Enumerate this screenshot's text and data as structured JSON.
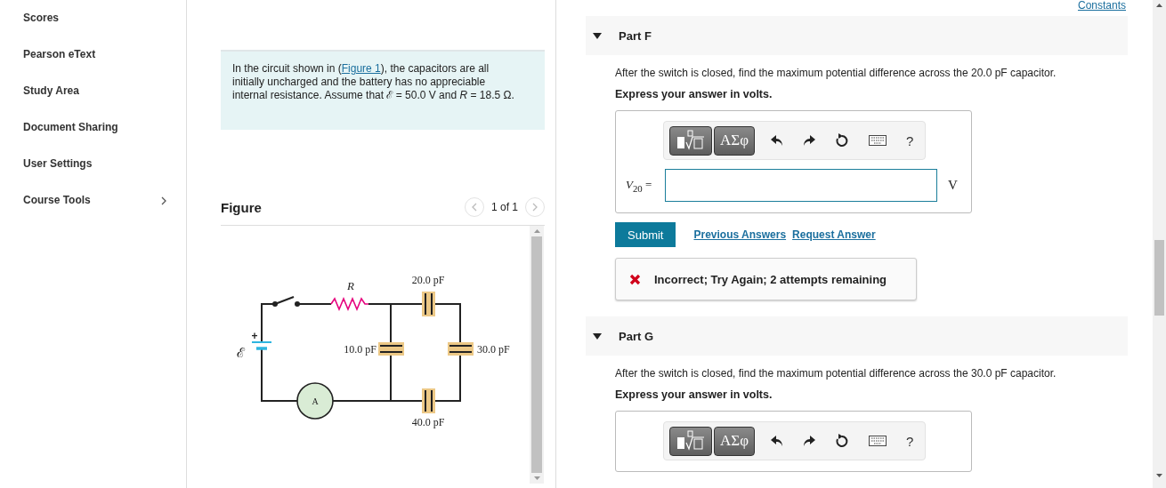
{
  "sidebar": {
    "items": [
      {
        "label": "Scores",
        "expandable": false
      },
      {
        "label": "Pearson eText",
        "expandable": false
      },
      {
        "label": "Study Area",
        "expandable": false
      },
      {
        "label": "Document Sharing",
        "expandable": false
      },
      {
        "label": "User Settings",
        "expandable": false
      },
      {
        "label": "Course Tools",
        "expandable": true
      }
    ]
  },
  "problem": {
    "before": "In the circuit shown in (",
    "link": "Figure 1",
    "after": "), the capacitors are all initially uncharged and the battery has no appreciable internal resistance. Assume that ℰ = 50.0 V and *R* = 18.5 Ω."
  },
  "figure": {
    "title": "Figure",
    "pager": "1 of 1",
    "prev_disabled": true,
    "next_disabled": true,
    "circuit_labels": {
      "emf": "ℰ",
      "plus": "+",
      "resistor": "R",
      "c20": "20.0 pF",
      "c10": "10.0 pF",
      "c30": "30.0 pF",
      "c40": "40.0 pF",
      "ammeter": "A"
    }
  },
  "constants_link": "Constants",
  "parts": [
    {
      "title": "Part F",
      "expanded": true,
      "prompt": "After the switch is closed, find the maximum potential difference across the 20.0 pF capacitor.",
      "instruction": "Express your answer in volts.",
      "toolbar": {
        "greek": "ΑΣφ",
        "help": "?"
      },
      "answer_label": "*V*$_{20}$ =",
      "unit": "V",
      "submit": "Submit",
      "links": [
        "Previous Answers",
        "Request Answer"
      ],
      "feedback": {
        "correct": false,
        "text": "Incorrect; Try Again; 2 attempts remaining"
      }
    },
    {
      "title": "Part G",
      "expanded": true,
      "prompt": "After the switch is closed, find the maximum potential difference across the 30.0 pF capacitor.",
      "instruction": "Express your answer in volts.",
      "toolbar": {
        "greek": "ΑΣφ",
        "help": "?"
      }
    }
  ]
}
